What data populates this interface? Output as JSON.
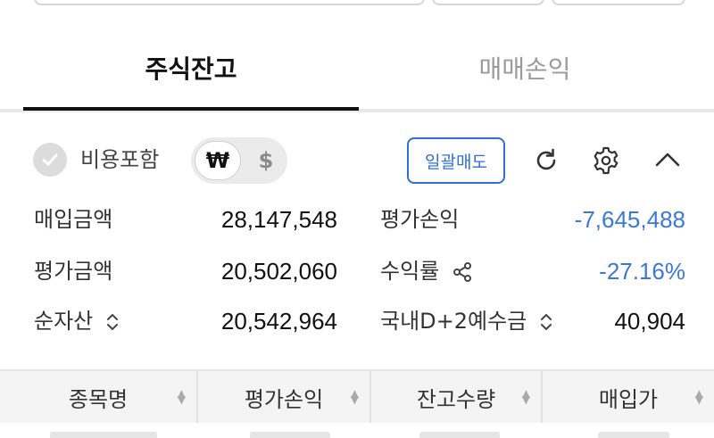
{
  "tabs": [
    {
      "label": "주식잔고",
      "active": true
    },
    {
      "label": "매매손익",
      "active": false
    }
  ],
  "options": {
    "include_fees_label": "비용포함",
    "currency_won": "₩",
    "currency_dollar": "$",
    "bulk_sell_label": "일괄매도",
    "refresh_icon": "refresh-icon",
    "settings_icon": "gear-icon",
    "collapse_icon": "chevron-up-icon"
  },
  "summary": {
    "purchase_amount_label": "매입금액",
    "purchase_amount_value": "28,147,548",
    "eval_pl_label": "평가손익",
    "eval_pl_value": "-7,645,488",
    "eval_amount_label": "평가금액",
    "eval_amount_value": "20,502,060",
    "return_rate_label": "수익률",
    "return_rate_value": "-27.16%",
    "net_asset_label": "순자산",
    "net_asset_value": "20,542,964",
    "deposit_label": "국내D+2예수금",
    "deposit_value": "40,904"
  },
  "table": {
    "columns": [
      "종목명",
      "평가손익",
      "잔고수량",
      "매입가"
    ]
  },
  "colors": {
    "accent_blue": "#2f6fd6",
    "negative_blue": "#3b78d8"
  }
}
